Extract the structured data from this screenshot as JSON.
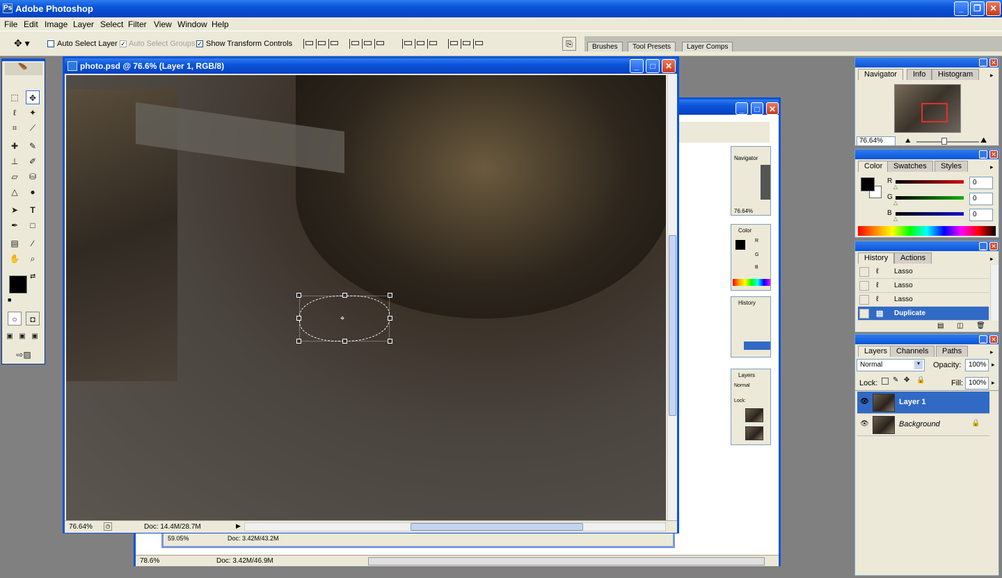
{
  "app": {
    "title": "Adobe Photoshop"
  },
  "menu": [
    "File",
    "Edit",
    "Image",
    "Layer",
    "Select",
    "Filter",
    "View",
    "Window",
    "Help"
  ],
  "options": {
    "auto_select_layer": "Auto Select Layer",
    "auto_select_groups": "Auto Select Groups",
    "show_transform_controls": "Show Transform Controls",
    "auto_select_layer_checked": false,
    "show_transform_checked": true
  },
  "palette_well": [
    "Brushes",
    "Tool Presets",
    "Layer Comps"
  ],
  "document": {
    "title": "photo.psd @ 76.6% (Layer 1, RGB/8)",
    "zoom": "76.64%",
    "doc_size": "Doc: 14.4M/28.7M"
  },
  "back_docs": [
    {
      "zoom": "59.05%",
      "doc_size": "Doc: 3.42M/43.2M"
    },
    {
      "zoom": "78.6%",
      "doc_size": "Doc: 3.42M/46.9M"
    }
  ],
  "mini_palettes": {
    "navigator": "Navigator",
    "zoom": "76.64%",
    "color": "Color",
    "history": "History",
    "layers": "Layers",
    "blend": "Normal",
    "lock": "Lock:",
    "channels": {
      "r": "R",
      "g": "G",
      "b": "B"
    }
  },
  "navigator": {
    "tabs": [
      "Navigator",
      "Info",
      "Histogram"
    ],
    "zoom": "76.64%"
  },
  "color": {
    "tabs": [
      "Color",
      "Swatches",
      "Styles"
    ],
    "channels": [
      {
        "label": "R",
        "value": "0",
        "color": "#d01010"
      },
      {
        "label": "G",
        "value": "0",
        "color": "#10b010"
      },
      {
        "label": "B",
        "value": "0",
        "color": "#1010d0"
      }
    ]
  },
  "history": {
    "tabs": [
      "History",
      "Actions"
    ],
    "items": [
      "Lasso",
      "Lasso",
      "Lasso",
      "Duplicate"
    ]
  },
  "layers": {
    "tabs": [
      "Layers",
      "Channels",
      "Paths"
    ],
    "blend_mode": "Normal",
    "opacity_label": "Opacity:",
    "opacity": "100%",
    "lock_label": "Lock:",
    "fill_label": "Fill:",
    "fill": "100%",
    "items": [
      "Layer 1",
      "Background"
    ]
  }
}
